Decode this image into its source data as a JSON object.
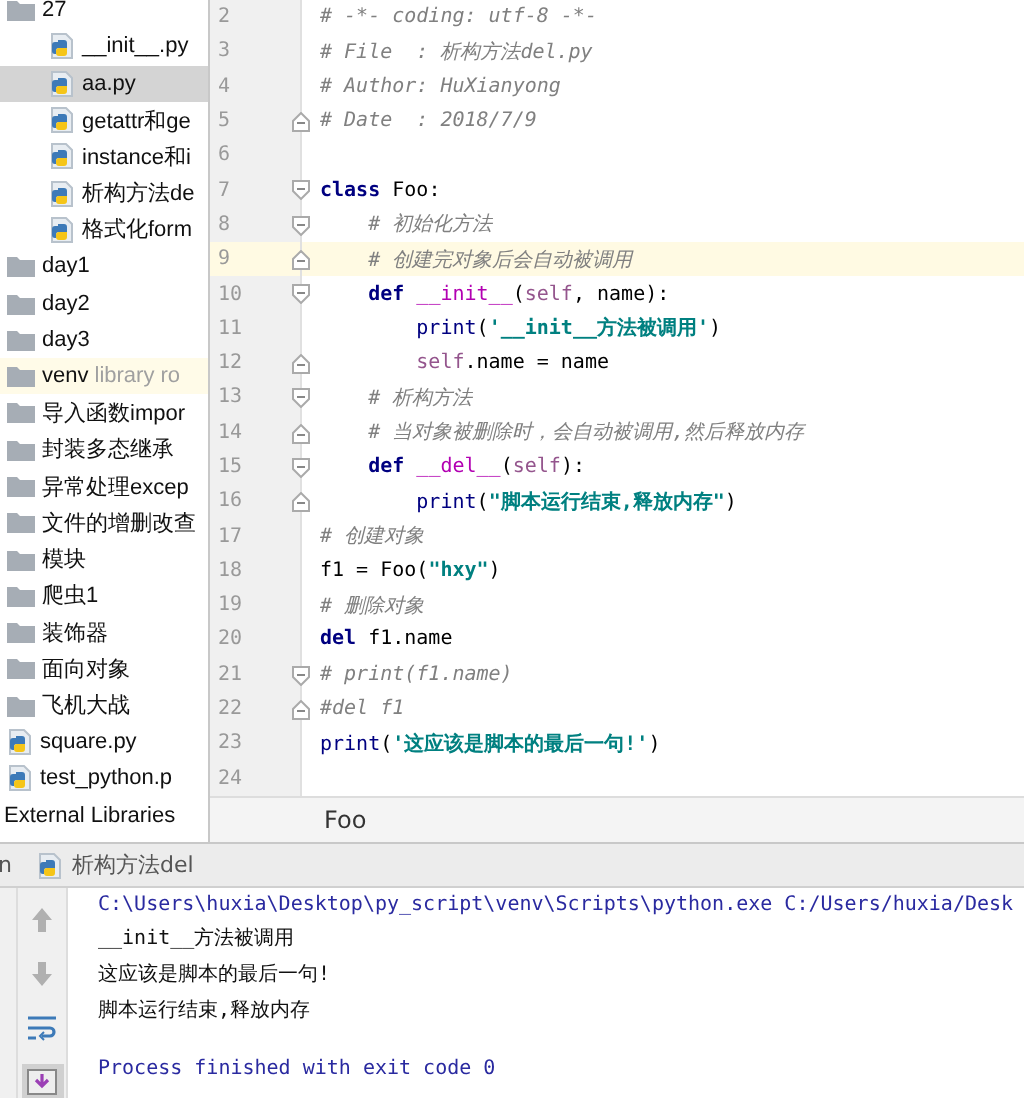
{
  "project_tree": [
    {
      "kind": "folder",
      "label": "27",
      "children": [
        {
          "kind": "file",
          "label": "__init__.py",
          "selected": false
        },
        {
          "kind": "file",
          "label": "aa.py",
          "selected": true
        },
        {
          "kind": "file",
          "label": "getattr和ge",
          "selected": false
        },
        {
          "kind": "file",
          "label": "instance和i",
          "selected": false
        },
        {
          "kind": "file",
          "label": "析构方法de",
          "selected": false
        },
        {
          "kind": "file",
          "label": "格式化form",
          "selected": false
        }
      ]
    },
    {
      "kind": "folder",
      "label": "day1"
    },
    {
      "kind": "folder",
      "label": "day2"
    },
    {
      "kind": "folder",
      "label": "day3"
    },
    {
      "kind": "folder",
      "label": "venv",
      "note": "library ro"
    },
    {
      "kind": "folder",
      "label": "导入函数impor"
    },
    {
      "kind": "folder",
      "label": "封装多态继承"
    },
    {
      "kind": "folder",
      "label": "异常处理excep"
    },
    {
      "kind": "folder",
      "label": "文件的增删改查"
    },
    {
      "kind": "folder",
      "label": "模块"
    },
    {
      "kind": "folder",
      "label": "爬虫1"
    },
    {
      "kind": "folder",
      "label": "装饰器"
    },
    {
      "kind": "folder",
      "label": "面向对象"
    },
    {
      "kind": "folder",
      "label": "飞机大战"
    },
    {
      "kind": "file",
      "label": "square.py",
      "selected": false
    },
    {
      "kind": "file",
      "label": "test_python.p",
      "selected": false
    },
    {
      "kind": "group",
      "label": "External Libraries"
    }
  ],
  "editor": {
    "lines": [
      {
        "number": "2",
        "tokens": [
          {
            "kind": "comment",
            "text": "# -*- coding: utf-8 -*-"
          }
        ]
      },
      {
        "number": "3",
        "tokens": [
          {
            "kind": "comment",
            "text": "# File  : 析构方法del.py"
          }
        ]
      },
      {
        "number": "4",
        "tokens": [
          {
            "kind": "comment",
            "text": "# Author: HuXianyong"
          }
        ]
      },
      {
        "number": "5",
        "fold_end": true,
        "tokens": [
          {
            "kind": "comment",
            "text": "# Date  : 2018/7/9"
          }
        ]
      },
      {
        "number": "6"
      },
      {
        "number": "7",
        "fold_start": true,
        "tokens": [
          {
            "kind": "keyword",
            "text": "class"
          },
          {
            "kind": "plain",
            "text": " Foo:"
          }
        ]
      },
      {
        "number": "8",
        "fold_start": true,
        "tokens": [
          {
            "kind": "comment",
            "text": "    # 初始化方法"
          }
        ]
      },
      {
        "number": "9",
        "fold_end": true,
        "current": true,
        "tokens": [
          {
            "kind": "comment",
            "text": "    # 创建完对象后会自动被调用"
          }
        ]
      },
      {
        "number": "10",
        "fold_start": true,
        "tokens": [
          {
            "kind": "keyword",
            "text": "    def "
          },
          {
            "kind": "magic",
            "text": "__init__"
          },
          {
            "kind": "plain",
            "text": "("
          },
          {
            "kind": "self",
            "text": "self"
          },
          {
            "kind": "plain",
            "text": ", name):"
          }
        ]
      },
      {
        "number": "11",
        "tokens": [
          {
            "kind": "builtin",
            "text": "        print"
          },
          {
            "kind": "plain",
            "text": "("
          },
          {
            "kind": "string",
            "text": "'__init__方法被调用'"
          },
          {
            "kind": "plain",
            "text": ")"
          }
        ]
      },
      {
        "number": "12",
        "fold_end": true,
        "tokens": [
          {
            "kind": "self",
            "text": "        self"
          },
          {
            "kind": "plain",
            "text": ".name = name"
          }
        ]
      },
      {
        "number": "13",
        "fold_start": true,
        "tokens": [
          {
            "kind": "comment",
            "text": "    # 析构方法"
          }
        ]
      },
      {
        "number": "14",
        "fold_end": true,
        "tokens": [
          {
            "kind": "comment",
            "text": "    # 当对象被删除时，会自动被调用,然后释放内存"
          }
        ]
      },
      {
        "number": "15",
        "fold_start": true,
        "tokens": [
          {
            "kind": "keyword",
            "text": "    def "
          },
          {
            "kind": "magic",
            "text": "__del__"
          },
          {
            "kind": "plain",
            "text": "("
          },
          {
            "kind": "self",
            "text": "self"
          },
          {
            "kind": "plain",
            "text": "):"
          }
        ]
      },
      {
        "number": "16",
        "fold_end": true,
        "tokens": [
          {
            "kind": "builtin",
            "text": "        print"
          },
          {
            "kind": "plain",
            "text": "("
          },
          {
            "kind": "string",
            "text": "\"脚本运行结束,释放内存\""
          },
          {
            "kind": "plain",
            "text": ")"
          }
        ]
      },
      {
        "number": "17",
        "tokens": [
          {
            "kind": "comment",
            "text": "# 创建对象"
          }
        ]
      },
      {
        "number": "18",
        "tokens": [
          {
            "kind": "plain",
            "text": "f1 = Foo("
          },
          {
            "kind": "string",
            "text": "\"hxy\""
          },
          {
            "kind": "plain",
            "text": ")"
          }
        ]
      },
      {
        "number": "19",
        "tokens": [
          {
            "kind": "comment",
            "text": "# 删除对象"
          }
        ]
      },
      {
        "number": "20",
        "tokens": [
          {
            "kind": "keyword",
            "text": "del"
          },
          {
            "kind": "plain",
            "text": " f1.name"
          }
        ]
      },
      {
        "number": "21",
        "fold_start": true,
        "tokens": [
          {
            "kind": "comment",
            "text": "# print(f1.name)"
          }
        ]
      },
      {
        "number": "22",
        "fold_end": true,
        "tokens": [
          {
            "kind": "comment",
            "text": "#del f1"
          }
        ]
      },
      {
        "number": "23",
        "tokens": [
          {
            "kind": "builtin",
            "text": "print"
          },
          {
            "kind": "plain",
            "text": "("
          },
          {
            "kind": "string",
            "text": "'这应该是脚本的最后一句!'"
          },
          {
            "kind": "plain",
            "text": ")"
          }
        ]
      },
      {
        "number": "24"
      }
    ],
    "breadcrumb": "Foo"
  },
  "run_panel": {
    "tab_prefix": "n",
    "tab_label": "析构方法del",
    "tools": [
      {
        "kind": "up",
        "selected": false
      },
      {
        "kind": "down",
        "selected": false
      },
      {
        "kind": "wrap",
        "selected": false
      },
      {
        "kind": "scroll-end",
        "selected": true
      }
    ],
    "output": [
      {
        "kind": "command",
        "text": "C:\\Users\\huxia\\Desktop\\py_script\\venv\\Scripts\\python.exe C:/Users/huxia/Desk"
      },
      {
        "kind": "output",
        "text": "__init__方法被调用"
      },
      {
        "kind": "output",
        "text": "这应该是脚本的最后一句!"
      },
      {
        "kind": "output",
        "text": "脚本运行结束,释放内存"
      },
      {
        "kind": "status",
        "text": "Process finished with exit code 0"
      }
    ]
  }
}
